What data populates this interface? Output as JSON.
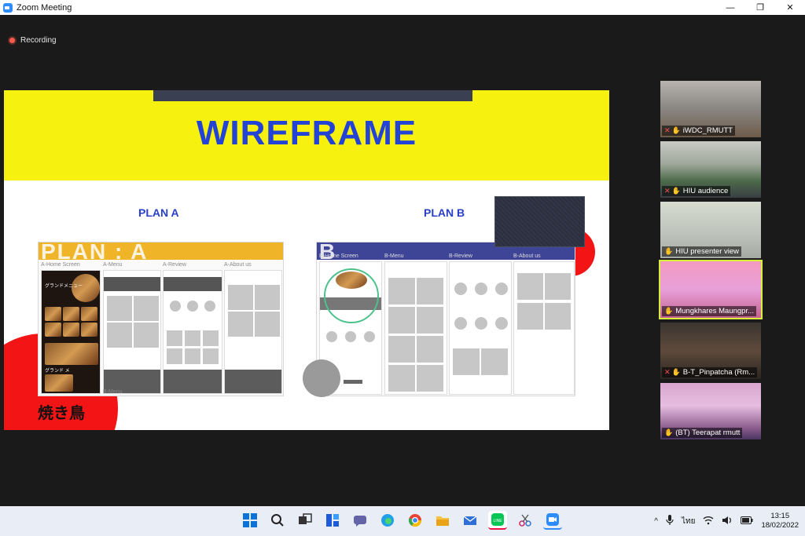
{
  "window": {
    "title": "Zoom Meeting",
    "minimize": "—",
    "maximize": "❐",
    "close": "✕"
  },
  "recording": {
    "label": "Recording"
  },
  "slide": {
    "title": "WIREFRAME",
    "plan_a_label": "PLAN A",
    "plan_b_label": "PLAN B",
    "plan_a": {
      "ribbon_text": "PLAN : A",
      "captions": [
        "A-Home Screen",
        "A-Menu",
        "A-Review",
        "A-About us"
      ],
      "sub_caption": "B-Menu",
      "jp_line1": "グランドメニュー",
      "jp_line2": "グランド メ",
      "kanji": "焼き鳥"
    },
    "plan_b": {
      "ribbon_text": "B",
      "captions": [
        "B-Home Screen",
        "B-Menu",
        "B-Review",
        "B-About us"
      ]
    }
  },
  "participants": [
    {
      "name": "iWDC_RMUTT",
      "muted": true
    },
    {
      "name": "HIU audience",
      "muted": true
    },
    {
      "name": "HIU presenter view",
      "muted": false
    },
    {
      "name": "Mungkhares Maungpr...",
      "muted": false,
      "active": true
    },
    {
      "name": "B-T_Pinpatcha (Rm...",
      "muted": true
    },
    {
      "name": "(BT) Teerapat rmutt",
      "muted": false
    }
  ],
  "taskbar": {
    "language": "ไทย",
    "time": "13:15",
    "date": "18/02/2022",
    "tray_chevron": "^"
  },
  "colors": {
    "slide_yellow": "#f6f10e",
    "title_blue": "#2343d6",
    "accent_red": "#f31515",
    "active_speaker": "#d8ef3a"
  }
}
